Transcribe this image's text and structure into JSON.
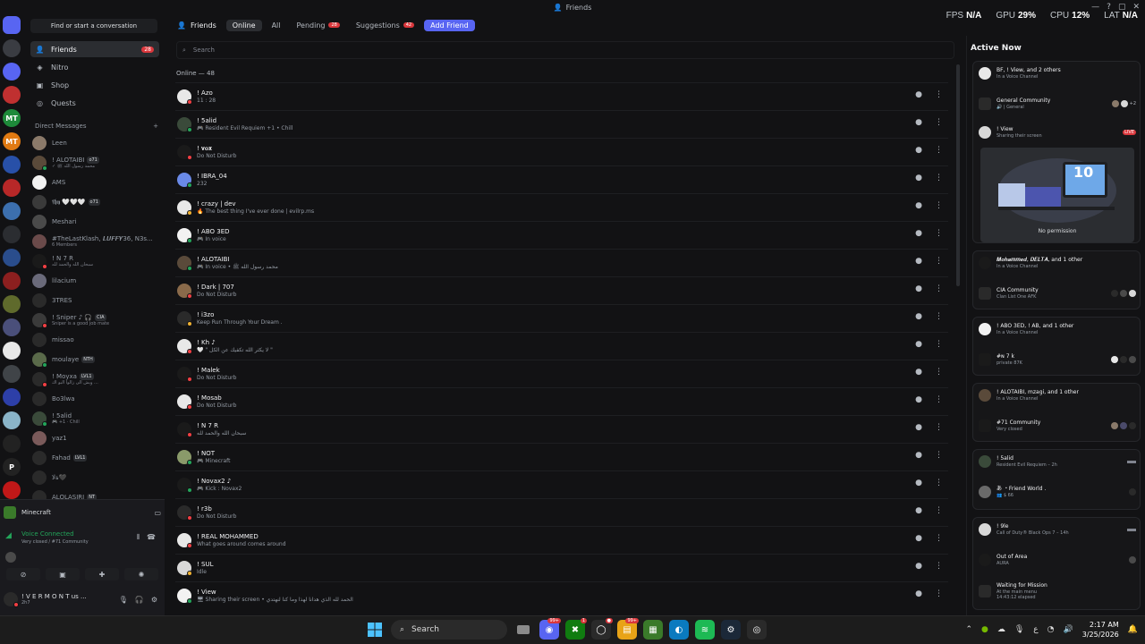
{
  "window": {
    "title": "Friends",
    "controls": [
      "—",
      "?",
      "▢",
      "✕"
    ]
  },
  "perf": {
    "fps_label": "FPS",
    "fps": "N/A",
    "gpu_label": "GPU",
    "gpu": "29%",
    "cpu_label": "CPU",
    "cpu": "12%",
    "lat_label": "LAT",
    "lat": "N/A"
  },
  "rail": [
    {
      "letter": "",
      "color": "#5865f2",
      "badge": "30"
    },
    {
      "letter": "",
      "color": "#3a3c42",
      "badge": "79"
    },
    {
      "letter": "",
      "color": "#5865f2",
      "badge": ""
    },
    {
      "letter": "",
      "color": "#c03030",
      "badge": "4"
    },
    {
      "letter": "MT",
      "color": "#1e8a3a",
      "badge": ""
    },
    {
      "letter": "MT",
      "color": "#e07a12",
      "badge": ""
    },
    {
      "letter": "",
      "color": "#2850a8",
      "badge": ""
    },
    {
      "letter": "",
      "color": "#b82828",
      "badge": ""
    },
    {
      "letter": "",
      "color": "#3c6fae",
      "badge": "48"
    },
    {
      "letter": "",
      "color": "#2b2d31",
      "badge": ""
    },
    {
      "letter": "",
      "color": "#2a4d8c",
      "badge": "1"
    },
    {
      "letter": "",
      "color": "#8c1f1f",
      "badge": ""
    },
    {
      "letter": "",
      "color": "#5f6a2c",
      "badge": ""
    },
    {
      "letter": "",
      "color": "#4a4f7a",
      "badge": ""
    },
    {
      "letter": "",
      "color": "#e8e8e8",
      "badge": ""
    },
    {
      "letter": "",
      "color": "#404448",
      "badge": ""
    },
    {
      "letter": "",
      "color": "#2d3fa8",
      "badge": "2"
    },
    {
      "letter": "",
      "color": "#8ab4c8",
      "badge": ""
    },
    {
      "letter": "",
      "color": "#222",
      "badge": ""
    },
    {
      "letter": "P",
      "color": "#222",
      "badge": ""
    },
    {
      "letter": "",
      "color": "#c01818",
      "badge": "NEW"
    }
  ],
  "sidebar": {
    "search_label": "Find or start a conversation",
    "nav": [
      {
        "label": "Friends",
        "icon": "friends-icon",
        "glyph": "👤",
        "count": "28"
      },
      {
        "label": "Nitro",
        "icon": "nitro-icon",
        "glyph": "◈",
        "count": ""
      },
      {
        "label": "Shop",
        "icon": "shop-icon",
        "glyph": "▣",
        "count": ""
      },
      {
        "label": "Quests",
        "icon": "quests-icon",
        "glyph": "◎",
        "count": ""
      }
    ],
    "dm_header": "Direct Messages",
    "dm_add": "+",
    "dms": [
      {
        "name": "Leen",
        "sub": "",
        "tag": "",
        "color": "#8b7a6a",
        "status": ""
      },
      {
        "name": "! ALOTAIBI",
        "sub": "✓ محمد رسول الله ﷺ",
        "tag": "o71",
        "color": "#5a4a3a",
        "status": "#23a55a"
      },
      {
        "name": "AMS",
        "sub": "",
        "tag": "",
        "color": "#f2f2f2",
        "status": ""
      },
      {
        "name": "𝖋𝖍𝖞 🤍🤍🤍",
        "sub": "",
        "tag": "o71",
        "color": "#3a3a3a",
        "status": ""
      },
      {
        "name": "Meshari",
        "sub": "",
        "tag": "",
        "color": "#4a4a4a",
        "status": ""
      },
      {
        "name": "#TheLastKlash, 𝑳𝑼𝑭𝑭𝒀36, N3s...",
        "sub": "6 Members",
        "tag": "",
        "color": "#6a4a4a",
        "status": ""
      },
      {
        "name": "! N 7 R",
        "sub": "سبحان الله والحمد لله",
        "tag": "",
        "color": "#1a1a1a",
        "status": "#f23f43"
      },
      {
        "name": "lilacium",
        "sub": "",
        "tag": "",
        "color": "#6a6a7a",
        "status": ""
      },
      {
        "name": "3TRES",
        "sub": "",
        "tag": "",
        "color": "#2a2a2a",
        "status": ""
      },
      {
        "name": "! Sniper ♪ 🎧",
        "sub": "Sniper is a good job mate",
        "tag": "CIA",
        "color": "#3a3a3a",
        "status": "#f23f43"
      },
      {
        "name": "missao",
        "sub": "",
        "tag": "",
        "color": "#2a2a2a",
        "status": ""
      },
      {
        "name": "moulaye",
        "sub": "",
        "tag": "NTH",
        "color": "#5a6a4a",
        "status": "#23a55a"
      },
      {
        "name": "! Moyxa",
        "sub": "ويش الى زالوا البو اك ...",
        "tag": "LVL1",
        "color": "#2a2a2a",
        "status": "#f23f43"
      },
      {
        "name": "Bo3lwa",
        "sub": "",
        "tag": "",
        "color": "#2a2a2a",
        "status": ""
      },
      {
        "name": "! 5alid",
        "sub": "🎮 +1 · Chill",
        "tag": "",
        "color": "#3a4a3a",
        "status": "#23a55a"
      },
      {
        "name": "yaz1",
        "sub": "",
        "tag": "",
        "color": "#7a5a5a",
        "status": ""
      },
      {
        "name": "Fahad",
        "sub": "",
        "tag": "LVL1",
        "color": "#2a2a2a",
        "status": ""
      },
      {
        "name": "ةلا🖤",
        "sub": "",
        "tag": "",
        "color": "#2a2a2a",
        "status": ""
      },
      {
        "name": "ALOLASIRI",
        "sub": "",
        "tag": "NT",
        "color": "#2a2a2a",
        "status": ""
      }
    ]
  },
  "bottom": {
    "game": "Minecraft",
    "voice_title": "Voice Connected",
    "voice_sub": "Very closed / #71 Community",
    "buttons": [
      "⊘",
      "▣",
      "✚",
      "✺"
    ],
    "user_name": "! V E R M O N T us ...",
    "user_status": "2h7",
    "user_ctrls": [
      "🎙",
      "🎧",
      "⚙"
    ]
  },
  "topbar": {
    "title": "Friends",
    "tabs": [
      {
        "label": "Online",
        "count": "",
        "selected": true
      },
      {
        "label": "All",
        "count": "",
        "selected": false
      },
      {
        "label": "Pending",
        "count": "28",
        "selected": false
      },
      {
        "label": "Suggestions",
        "count": "42",
        "selected": false
      }
    ],
    "add_friend": "Add Friend"
  },
  "search": {
    "placeholder": "Search"
  },
  "online_label": "Online — 48",
  "friends": [
    {
      "name": "! Azo",
      "sub": "11 : 28",
      "color": "#e8e8e8",
      "status": "#f23f43"
    },
    {
      "name": "! 5alid",
      "sub": "🎮 Resident Evil Requiem +1 • Chill",
      "color": "#3a4a3a",
      "status": "#23a55a"
    },
    {
      "name": "! 𝐯𝐨𝐱",
      "sub": "Do Not Disturb",
      "color": "#1a1a1a",
      "status": "#f23f43"
    },
    {
      "name": "! IBRA_04",
      "sub": "232",
      "color": "#6a8ae8",
      "status": "#23a55a"
    },
    {
      "name": "! crazy | dev",
      "sub": "🔥 The best thing I've ever done | evilrp.ms",
      "color": "#e8e8e8",
      "status": "#f0b232"
    },
    {
      "name": "! ABO 3ED",
      "sub": "🎮 In voice",
      "color": "#f2f2f2",
      "status": "#23a55a"
    },
    {
      "name": "! ALOTAIBI",
      "sub": "🎮 In voice • محمد رسول الله ﷺ",
      "color": "#5a4a3a",
      "status": "#23a55a"
    },
    {
      "name": "! Dark | 707",
      "sub": "Do Not Disturb",
      "color": "#8a6a4a",
      "status": "#f23f43"
    },
    {
      "name": "! i3zo",
      "sub": "Keep Run Through Your Dream .",
      "color": "#2a2a2a",
      "status": "#f0b232"
    },
    {
      "name": "! Kh ♪",
      "sub": "🤍 \" لا يكثر الله تكفيك عن الكل \"",
      "color": "#e8e8e8",
      "status": "#f23f43"
    },
    {
      "name": "! Malek",
      "sub": "Do Not Disturb",
      "color": "#1a1a1a",
      "status": "#f23f43"
    },
    {
      "name": "! Mosab",
      "sub": "Do Not Disturb",
      "color": "#e8e8e8",
      "status": "#f23f43"
    },
    {
      "name": "! N 7 R",
      "sub": "سبحان الله والحمد لله",
      "color": "#1a1a1a",
      "status": "#f23f43"
    },
    {
      "name": "! NOT",
      "sub": "🎮 Minecraft",
      "color": "#8a9a6a",
      "status": "#23a55a"
    },
    {
      "name": "! Novax2 ♪",
      "sub": "🎮 Kick : Novax2",
      "color": "#1a1a1a",
      "status": "#23a55a"
    },
    {
      "name": "! r3b",
      "sub": "Do Not Disturb",
      "color": "#2a2a2a",
      "status": "#f23f43"
    },
    {
      "name": "! REAL MOHAMMED",
      "sub": "What goes around comes around",
      "color": "#e8e8e8",
      "status": "#f23f43"
    },
    {
      "name": "! SUL",
      "sub": "Idle",
      "color": "#d8d8d8",
      "status": "#f0b232"
    },
    {
      "name": "! View",
      "sub": "🖥 Sharing their screen • الحمد لله الذي هدانا لهذا وما كنا لنهتدي",
      "color": "#f2f2f2",
      "status": "#23a55a"
    }
  ],
  "active": {
    "title": "Active Now",
    "c1": {
      "name": "BF, ! View, and 2 others",
      "sub": "In a Voice Channel",
      "server": "General Community",
      "server_sub": "🔊 | General",
      "more": "+2",
      "user": "! View",
      "user_sub": "Sharing their screen",
      "live": "LIVE",
      "stream_number": "10",
      "no_perm": "No permission"
    },
    "c2": {
      "name": "𝑴𝒐𝒉𝒂𝒎𝒎𝒆𝒅, 𝑫𝑬𝑳𝑻𝑨, and 1 other",
      "sub": "In a Voice Channel",
      "server": "CIA Community",
      "server_sub": "Clan List One AFK"
    },
    "c3": {
      "name": "! ABO 3ED, ! AB, and 1 other",
      "sub": "In a Voice Channel",
      "server": "#ɴ 7 k",
      "server_sub": "private 87K"
    },
    "c4": {
      "name": "! ALOTAIBI, mzagi, and 1 other",
      "sub": "In a Voice Channel",
      "server": "#71 Community",
      "server_sub": "Very closed"
    },
    "c5": {
      "name": "! 5alid",
      "sub": "Resident Evil Requiem – 2h",
      "name2": "あ ・Friend World .",
      "sub2": "👥 $ 66"
    },
    "c6": {
      "name": "! 9le",
      "sub": "Call of Duty® Black Ops 7 – 14h",
      "name2": "Out of Area",
      "sub2": "AURA",
      "name3": "Waiting for Mission",
      "sub3": "At the main menu",
      "sub3b": "14:43:12 elapsed"
    }
  },
  "taskbar": {
    "search": "Search",
    "apps": [
      {
        "icon": "discord-icon",
        "glyph": "◉",
        "color": "#5865f2",
        "badge": "99+"
      },
      {
        "icon": "xbox-icon",
        "glyph": "✖",
        "color": "#107c10",
        "badge": "1"
      },
      {
        "icon": "github-icon",
        "glyph": "◯",
        "color": "#2a2a2a",
        "badge": "●"
      },
      {
        "icon": "files-icon",
        "glyph": "▤",
        "color": "#e8a317",
        "badge": "99+"
      },
      {
        "icon": "minecraft-icon",
        "glyph": "▦",
        "color": "#3a7a2a",
        "badge": ""
      },
      {
        "icon": "edge-icon",
        "glyph": "◐",
        "color": "#0a7abf",
        "badge": ""
      },
      {
        "icon": "spotify-icon",
        "glyph": "≋",
        "color": "#1db954",
        "badge": ""
      },
      {
        "icon": "steam-icon",
        "glyph": "⚙",
        "color": "#1b2838",
        "badge": ""
      },
      {
        "icon": "chrome-icon",
        "glyph": "◎",
        "color": "#2a2a2a",
        "badge": ""
      }
    ],
    "time": "2:17 AM",
    "date": "3/25/2026",
    "lang": "ع"
  },
  "colors": {
    "accent": "#5865f2",
    "online": "#23a55a",
    "dnd": "#f23f43",
    "idle": "#f0b232",
    "badge": "#da373c"
  }
}
